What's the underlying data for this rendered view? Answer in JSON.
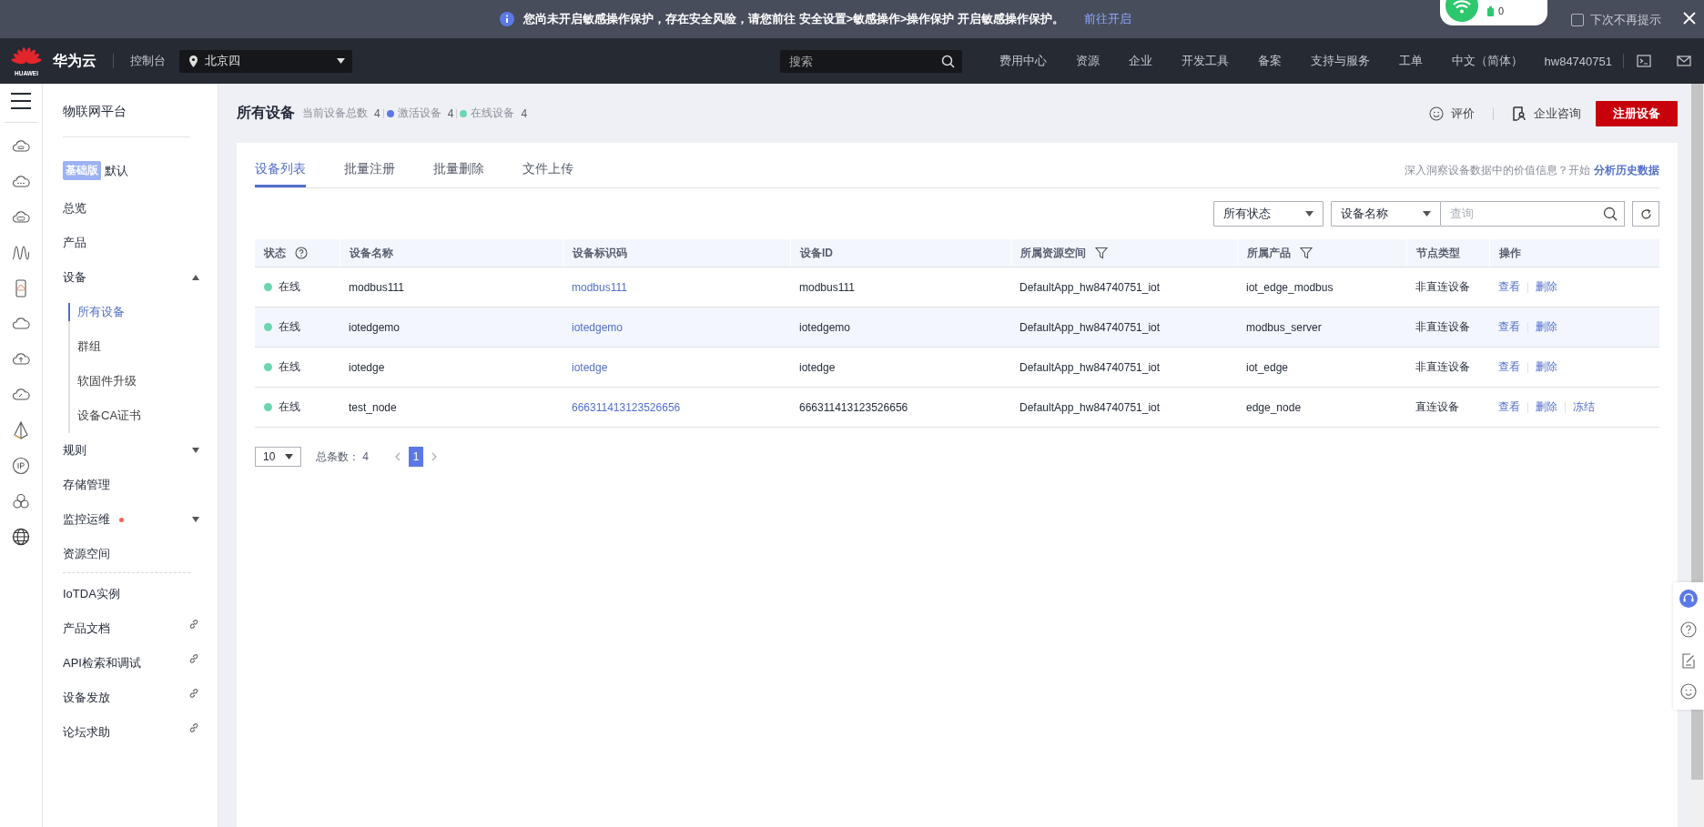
{
  "banner": {
    "message": "您尚未开启敏感操作保护，存在安全风险，请您前往 安全设置>敏感操作>操作保护 开启敏感操作保护。",
    "link": "前往开启",
    "dont_show": {
      "label": "下次不再提示",
      "checked": false
    }
  },
  "network_popup": {
    "count": "0"
  },
  "header": {
    "logo_text": "HUAWEI",
    "brand": "华为云",
    "console": "控制台",
    "region": "北京四",
    "search_placeholder": "搜索",
    "nav": [
      "费用中心",
      "资源",
      "企业",
      "开发工具",
      "备案",
      "支持与服务",
      "工单",
      "中文（简体）"
    ],
    "user": "hw84740751"
  },
  "sidebar": {
    "title": "物联网平台",
    "edition": {
      "badge": "基础版",
      "name": "默认"
    },
    "groups": [
      [
        {
          "label": "总览",
          "kind": "item"
        },
        {
          "label": "产品",
          "kind": "item"
        },
        {
          "label": "设备",
          "kind": "item",
          "expanded": true,
          "children": [
            {
              "label": "所有设备",
              "selected": true
            },
            {
              "label": "群组",
              "selected": false
            },
            {
              "label": "软固件升级",
              "selected": false
            },
            {
              "label": "设备CA证书",
              "selected": false
            }
          ]
        },
        {
          "label": "规则",
          "kind": "item",
          "expanded": false
        },
        {
          "label": "存储管理",
          "kind": "item"
        },
        {
          "label": "监控运维",
          "kind": "item",
          "expanded": false,
          "color": "#f0625b"
        },
        {
          "label": "资源空间",
          "kind": "item"
        }
      ],
      [
        {
          "label": "IoTDA实例",
          "kind": "item"
        },
        {
          "label": "产品文档",
          "kind": "external"
        },
        {
          "label": "API检索和调试",
          "kind": "external"
        },
        {
          "label": "设备发放",
          "kind": "external"
        },
        {
          "label": "论坛求助",
          "kind": "external"
        }
      ]
    ]
  },
  "page": {
    "title": "所有设备",
    "stats": [
      {
        "label": "当前设备总数",
        "count": "4"
      },
      {
        "label": "激活设备",
        "count": "4",
        "color": "#5b79e6"
      },
      {
        "label": "在线设备",
        "count": "4",
        "color": "#6cd6b3"
      }
    ],
    "rate": "评价",
    "consult": "企业咨询",
    "register": "注册设备"
  },
  "tabs": [
    {
      "label": "设备列表",
      "selected": true
    },
    {
      "label": "批量注册",
      "selected": false
    },
    {
      "label": "批量删除",
      "selected": false
    },
    {
      "label": "文件上传",
      "selected": false
    }
  ],
  "insight": {
    "text": "深入洞察设备数据中的价值信息？开始",
    "link": "分析历史数据"
  },
  "filters": {
    "status": "所有状态",
    "field": "设备名称",
    "search_placeholder": "查询"
  },
  "table": {
    "columns": [
      {
        "label": "状态",
        "help": true
      },
      {
        "label": "设备名称"
      },
      {
        "label": "设备标识码"
      },
      {
        "label": "设备ID"
      },
      {
        "label": "所属资源空间",
        "filter": true
      },
      {
        "label": "所属产品",
        "filter": true
      },
      {
        "label": "节点类型"
      },
      {
        "label": "操作"
      }
    ],
    "rows": [
      {
        "status": {
          "text": "在线",
          "color": "#6cd6b3"
        },
        "name": "modbus111",
        "node_id": "modbus111",
        "device_id": "modbus111",
        "space": "DefaultApp_hw84740751_iot",
        "product": "iot_edge_modbus",
        "node_type": "非直连设备",
        "actions": [
          "查看",
          "删除"
        ],
        "highlighted": false
      },
      {
        "status": {
          "text": "在线",
          "color": "#6cd6b3"
        },
        "name": "iotedgemo",
        "node_id": "iotedgemo",
        "device_id": "iotedgemo",
        "space": "DefaultApp_hw84740751_iot",
        "product": "modbus_server",
        "node_type": "非直连设备",
        "actions": [
          "查看",
          "删除"
        ],
        "highlighted": true
      },
      {
        "status": {
          "text": "在线",
          "color": "#6cd6b3"
        },
        "name": "iotedge",
        "node_id": "iotedge",
        "device_id": "iotedge",
        "space": "DefaultApp_hw84740751_iot",
        "product": "iot_edge",
        "node_type": "非直连设备",
        "actions": [
          "查看",
          "删除"
        ],
        "highlighted": false
      },
      {
        "status": {
          "text": "在线",
          "color": "#6cd6b3"
        },
        "name": "test_node",
        "node_id": "666311413123526656",
        "device_id": "666311413123526656",
        "space": "DefaultApp_hw84740751_iot",
        "product": "edge_node",
        "node_type": "直连设备",
        "actions": [
          "查看",
          "删除",
          "冻结"
        ],
        "highlighted": false
      }
    ]
  },
  "pagination": {
    "page_size": "10",
    "total_label": "总条数：",
    "total": "4",
    "pages": [
      {
        "label": "1",
        "selected": true
      }
    ]
  }
}
